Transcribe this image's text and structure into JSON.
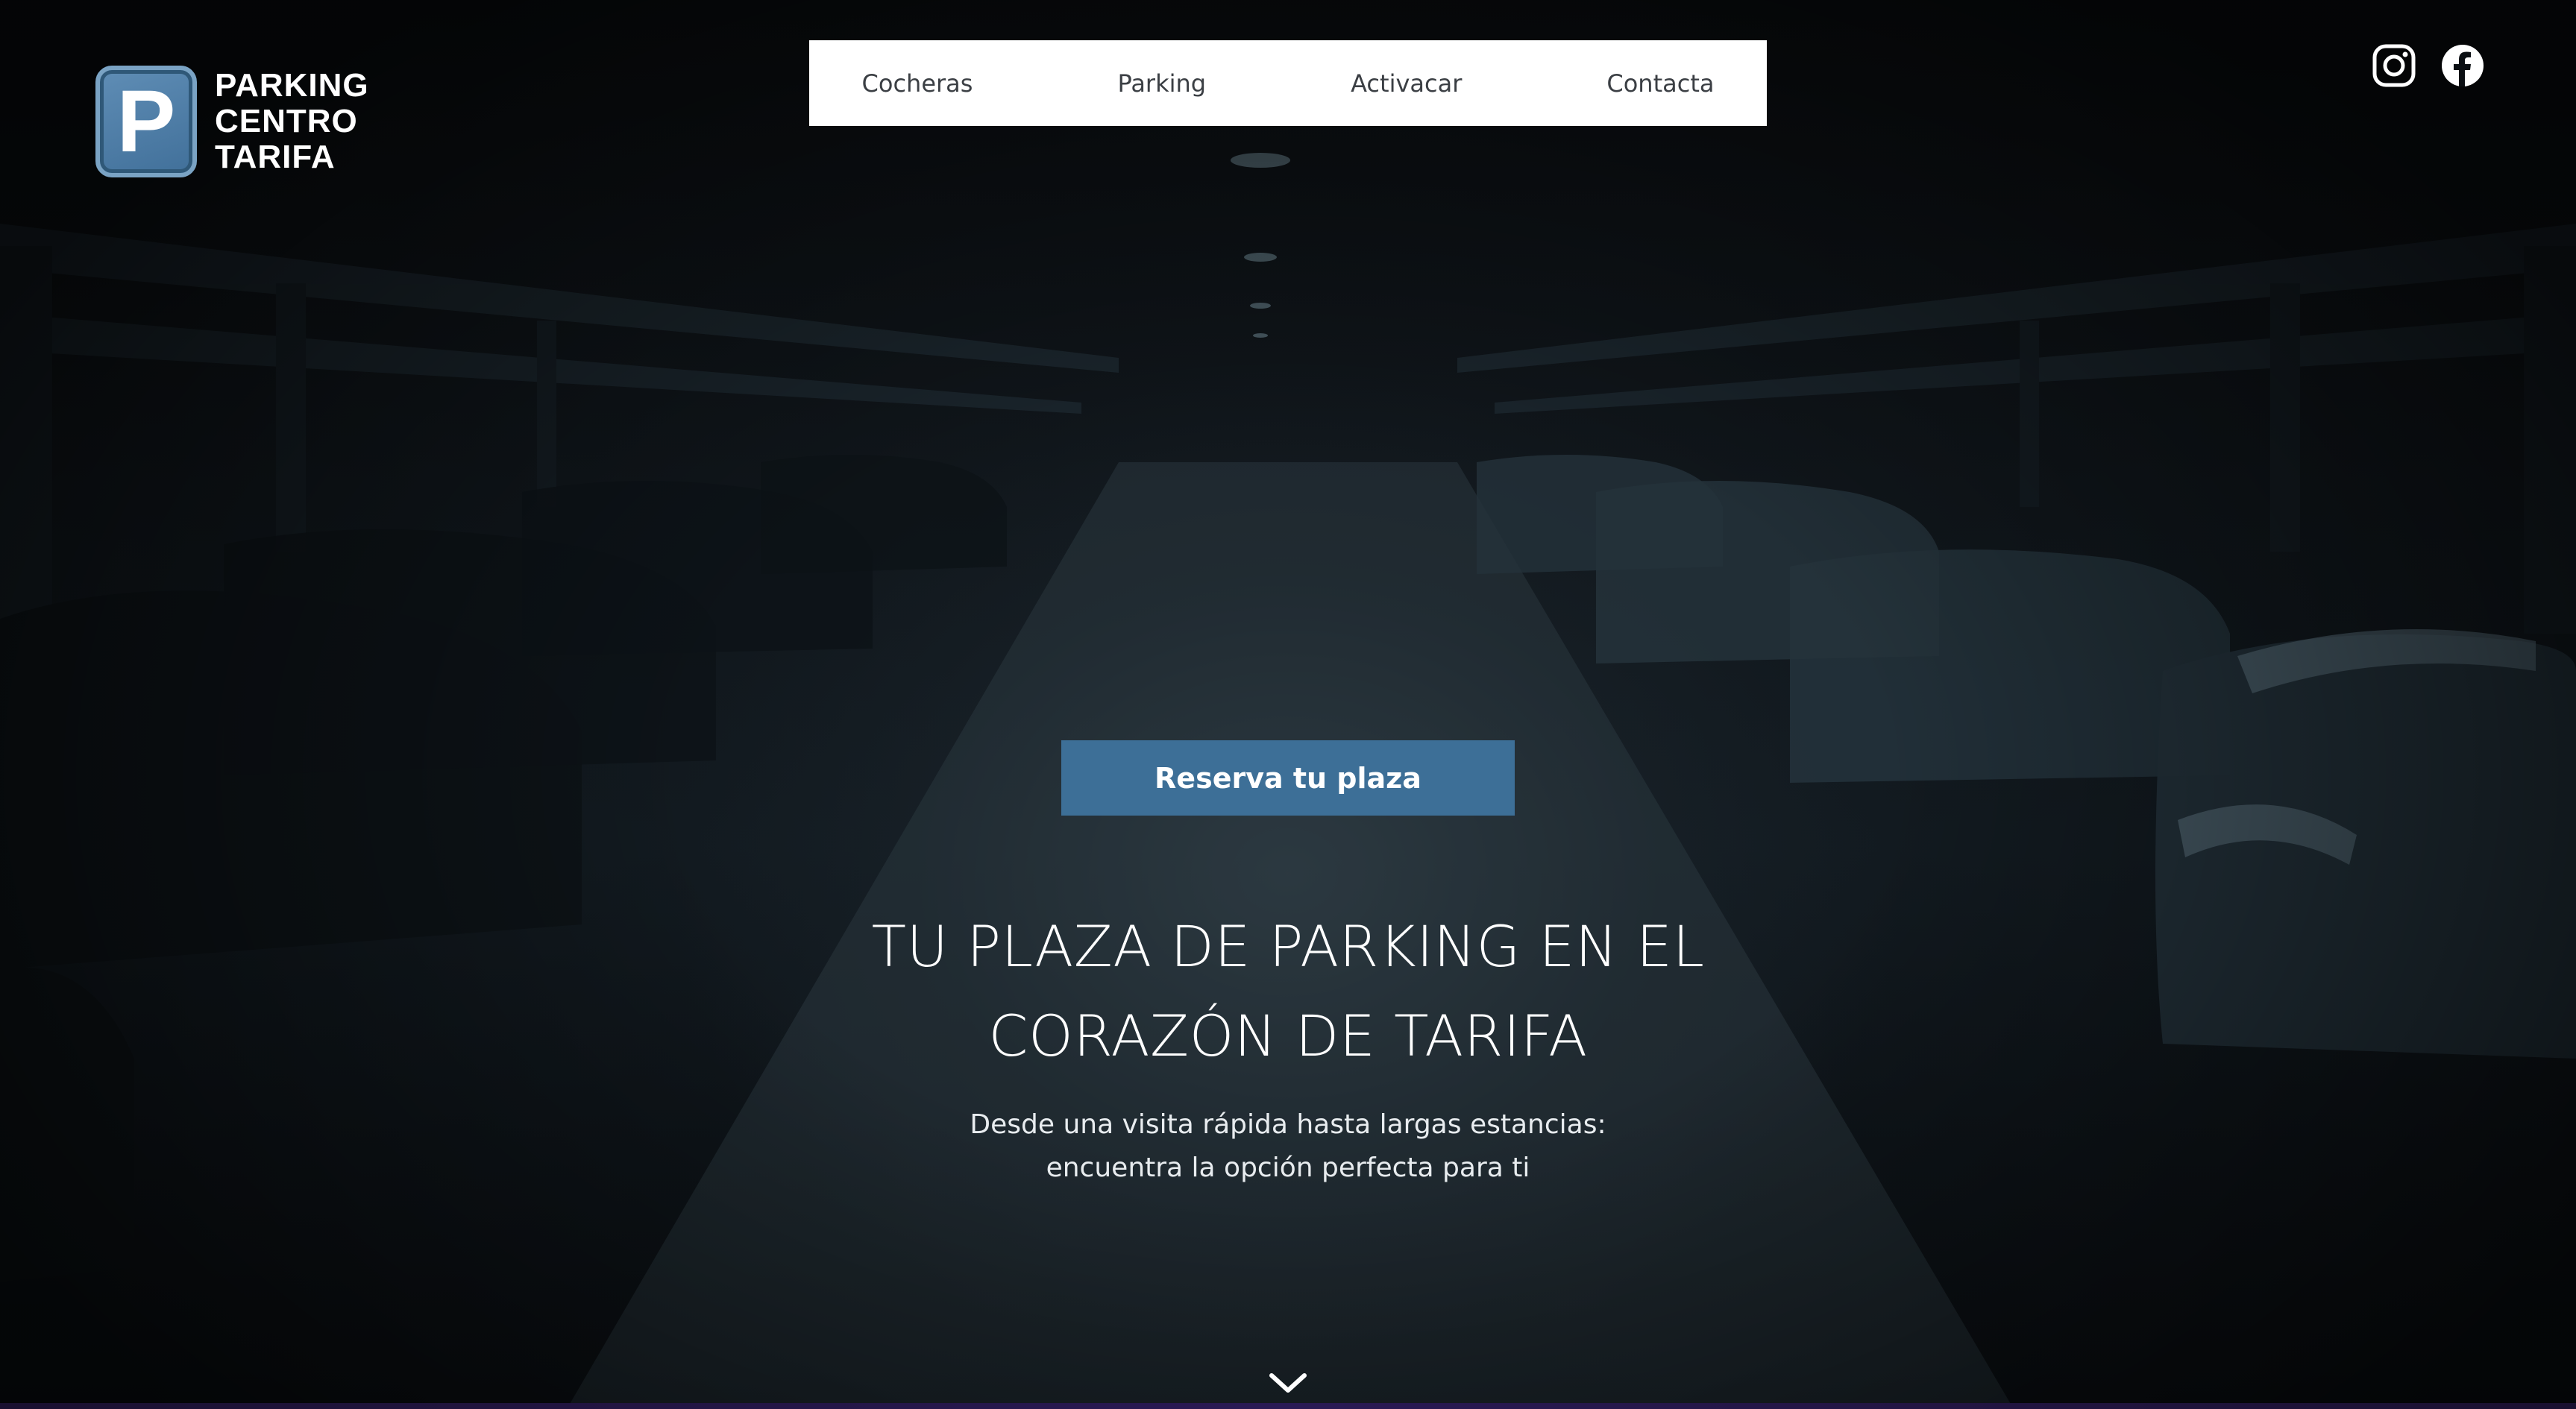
{
  "logo": {
    "mark": "P",
    "lines": [
      "PARKING",
      "CENTRO",
      "TARIFA"
    ]
  },
  "nav": {
    "items": [
      {
        "label": "Cocheras"
      },
      {
        "label": "Parking"
      },
      {
        "label": "Activacar"
      },
      {
        "label": "Contacta"
      }
    ]
  },
  "social": {
    "icons": [
      "instagram-icon",
      "facebook-icon"
    ]
  },
  "hero": {
    "cta_label": "Reserva tu plaza",
    "title_lines": [
      "TU PLAZA DE PARKING EN EL",
      "CORAZÓN DE TARIFA"
    ],
    "subtitle_lines": [
      "Desde una visita rápida hasta largas estancias:",
      "encuentra la opción perfecta para ti"
    ],
    "scroll_icon": "chevron-down-icon"
  },
  "colors": {
    "accent": "#3d6f97",
    "logo_blue": "#5f8db5",
    "nav_bg": "#ffffff",
    "nav_text": "#3b3f44",
    "hero_text": "#ffffff"
  }
}
